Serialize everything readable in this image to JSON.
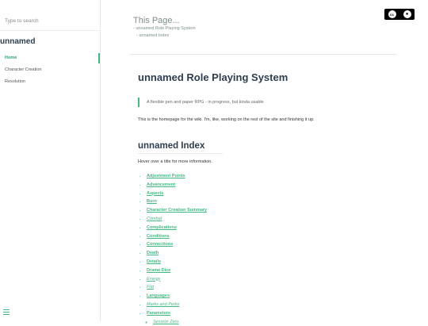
{
  "sidebar": {
    "search_placeholder": "Type to search",
    "brand": "unnamed",
    "items": [
      {
        "label": "Home"
      },
      {
        "label": "Character Creation"
      },
      {
        "label": "Resolution"
      }
    ]
  },
  "header": {
    "title": "This Page...",
    "links": [
      "- unnamed Role Playing System",
      "- unnamed Index"
    ]
  },
  "license_badge": {
    "text": "cc",
    "by": "BY"
  },
  "main": {
    "title": "unnamed Role Playing System",
    "tip": "A flexible pen and paper RPG - in progress, but kinda usable",
    "intro": "This is the homepage for the wiki. I'm, like, working on the rest of the site and finishing it up.",
    "index_title": "unnamed Index",
    "hint": "Hover over a title for more information.",
    "index_items": [
      "Adjustment Points",
      "Advancement",
      "Aspects",
      "Burn",
      "Character Creation Summary",
      "Combat",
      "Complications",
      "Conditions",
      "Connections",
      "Death",
      "Details",
      "Drama Dice",
      "Energy",
      "Fiat",
      "Languages",
      "Marks and Perks",
      "Parameters"
    ],
    "sub_items": [
      "Session Zero"
    ]
  },
  "colors": {
    "accent": "#42b983",
    "heading": "#2c3e50"
  }
}
